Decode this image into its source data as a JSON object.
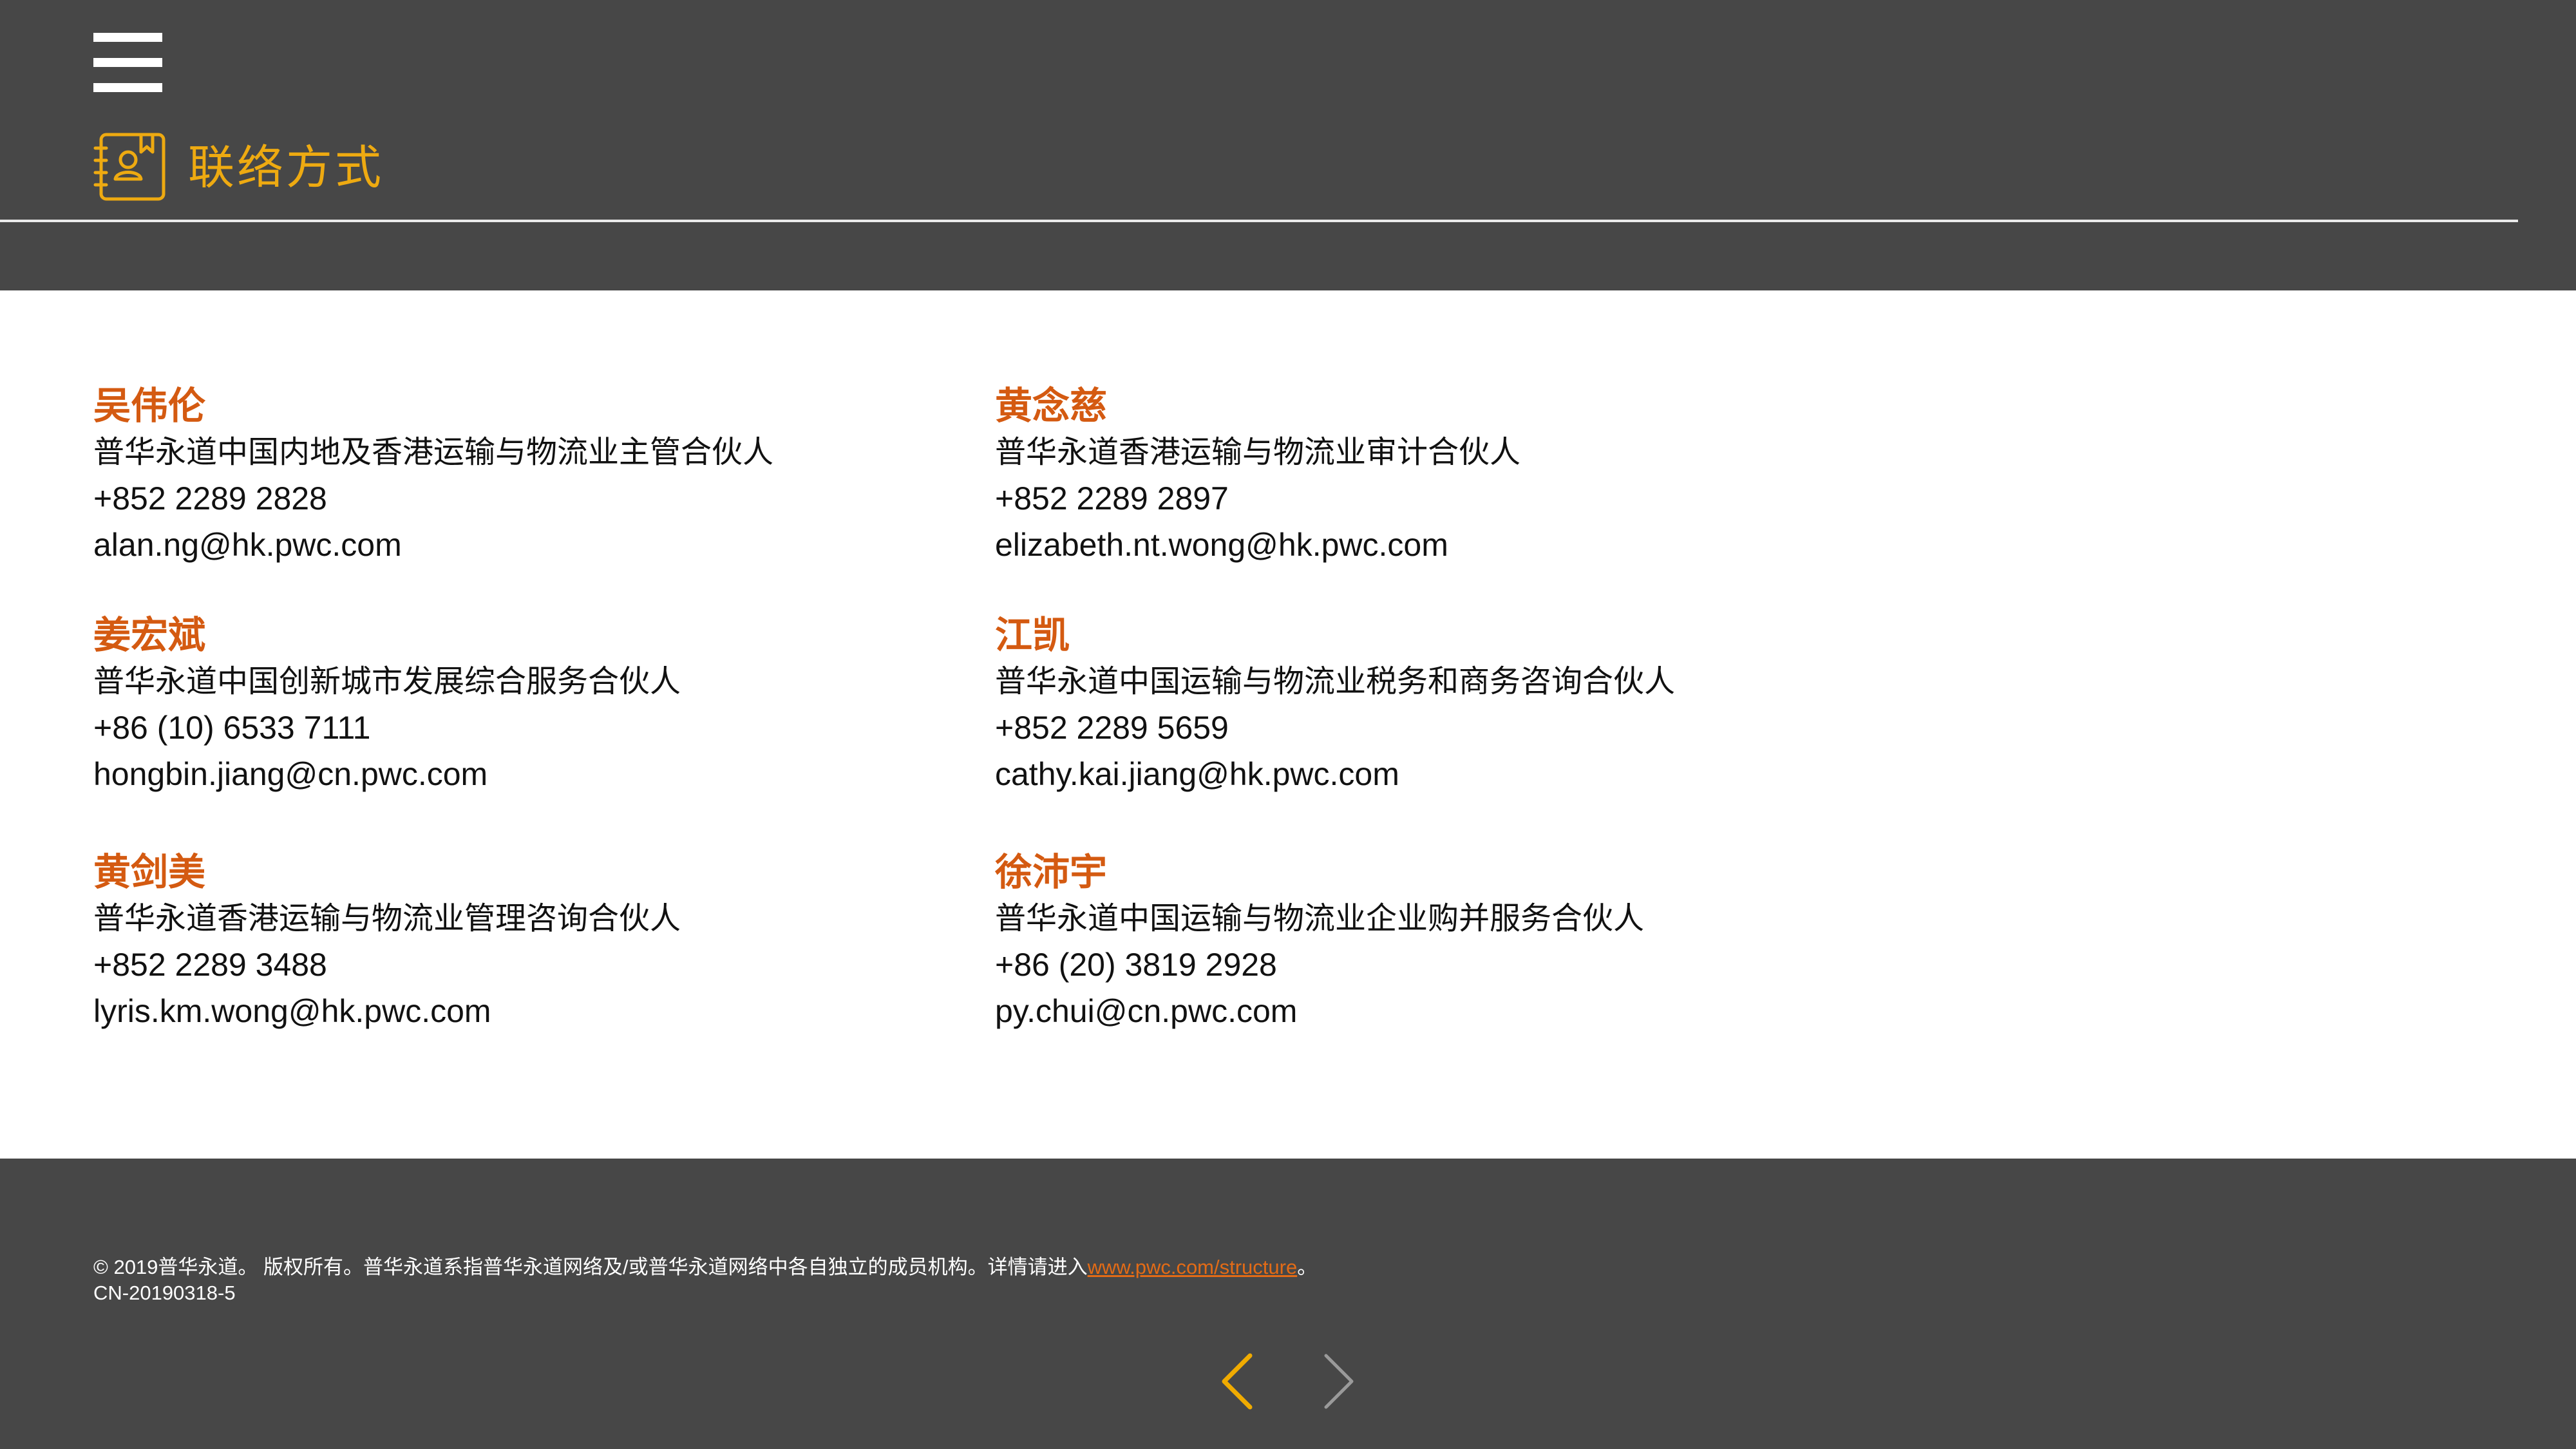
{
  "header": {
    "title": "联络方式",
    "icons": {
      "menu": "hamburger-menu-icon",
      "section": "contact-book-icon"
    }
  },
  "contacts": [
    {
      "name": "吴伟伦",
      "role": "普华永道中国内地及香港运输与物流业主管合伙人",
      "phone": "+852 2289 2828",
      "email": "alan.ng@hk.pwc.com"
    },
    {
      "name": "黄念慈",
      "role": "普华永道香港运输与物流业审计合伙人",
      "phone": "+852 2289 2897",
      "email": "elizabeth.nt.wong@hk.pwc.com"
    },
    {
      "name": "姜宏斌",
      "role": "普华永道中国创新城市发展综合服务合伙人",
      "phone": "+86 (10) 6533 7111",
      "email": "hongbin.jiang@cn.pwc.com"
    },
    {
      "name": "江凯",
      "role": "普华永道中国运输与物流业税务和商务咨询合伙人",
      "phone": "+852 2289 5659",
      "email": "cathy.kai.jiang@hk.pwc.com"
    },
    {
      "name": "黄剑美",
      "role": "普华永道香港运输与物流业管理咨询合伙人",
      "phone": "+852 2289 3488",
      "email": "lyris.km.wong@hk.pwc.com"
    },
    {
      "name": "徐沛宇",
      "role": "普华永道中国运输与物流业企业购并服务合伙人",
      "phone": "+86 (20) 3819 2928",
      "email": "py.chui@cn.pwc.com"
    }
  ],
  "footer": {
    "copyright_prefix": "© 2019普华永道。 版权所有。普华永道系指普华永道网络及/或普华永道网络中各自独立的成员机构。详情请进入",
    "link_text": "www.pwc.com/structure",
    "copyright_suffix": "。",
    "doc_id": "CN-20190318-5",
    "nav": {
      "prev_icon": "chevron-left-icon",
      "next_icon": "chevron-right-icon"
    }
  },
  "colors": {
    "header_bg": "#474747",
    "accent_title": "#eeaa11",
    "name_color": "#d45a11",
    "link_color": "#e36b16",
    "nav_prev": "#f0ab00",
    "nav_next": "#9a9a9a"
  }
}
